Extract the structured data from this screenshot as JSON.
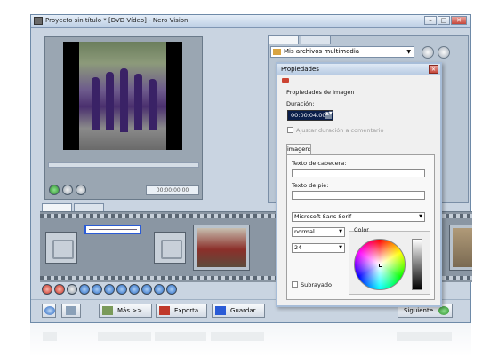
{
  "window": {
    "title": "Proyecto sin título * [DVD Vídeo] - Nero Vision",
    "min": "–",
    "max": "□",
    "close": "✕"
  },
  "preview": {
    "timecode": "00:00:00.00"
  },
  "media": {
    "selected": "Mis archivos multimedia",
    "arrow": "▼"
  },
  "dialog": {
    "title": "Propiedades",
    "close": "✕",
    "section_title": "Propiedades de imagen",
    "duration_label": "Duración:",
    "duration_value": "00:00:04.00",
    "spin_arrows": "▲▼",
    "adjust_label": "Ajustar duración a comentario",
    "tab_label": "imagen:",
    "header_text_label": "Texto de cabecera:",
    "footer_text_label": "Texto de pie:",
    "font_value": "Microsoft Sans Serif",
    "style_value": "normal",
    "size_value": "24",
    "dropdown_arrow": "▼",
    "color_label": "Color",
    "underline_label": "Subrayado"
  },
  "bottombar": {
    "help": "",
    "more_label": "Más >>",
    "export_label": "Exporta",
    "save_label": "Guardar",
    "next_label": "Siguiente"
  },
  "colors": {
    "accent": "#2a5bd6",
    "app_bg": "#c9d4e1",
    "duration_bg": "#0b1f4a"
  }
}
